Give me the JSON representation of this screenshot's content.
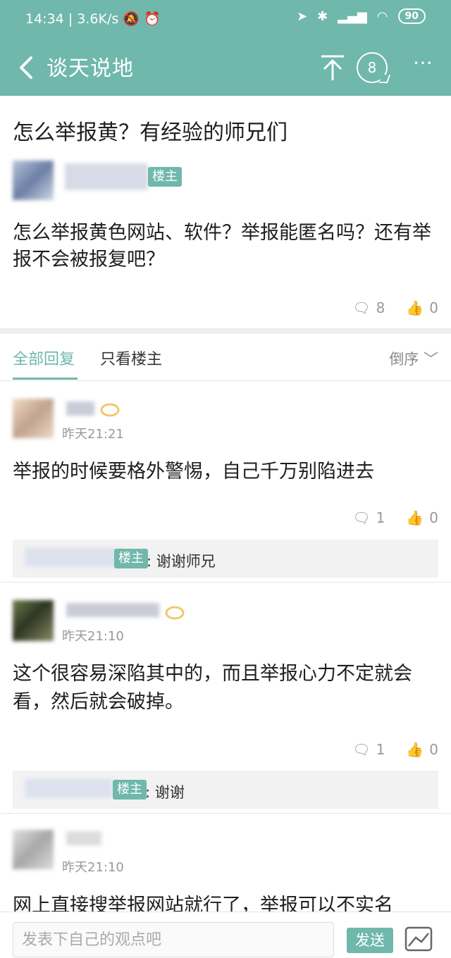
{
  "status": {
    "time": "14:34",
    "speed": "3.6K/s",
    "battery": "90"
  },
  "header": {
    "title": "谈天说地",
    "comment_count": "8"
  },
  "post": {
    "title": "怎么举报黄？有经验的师兄们",
    "author_tag": "楼主",
    "body": "怎么举报黄色网站、软件？举报能匿名吗？还有举报不会被报复吧？",
    "comments": "8",
    "likes": "0"
  },
  "tabs": {
    "all": "全部回复",
    "owner": "只看楼主",
    "sort": "倒序"
  },
  "replies": [
    {
      "time": "昨天21:21",
      "text": "举报的时候要格外警惕，自己千万别陷进去",
      "comments": "1",
      "likes": "0",
      "sub_tag": "楼主",
      "sub_text": "谢谢师兄"
    },
    {
      "time": "昨天21:10",
      "text": "这个很容易深陷其中的，而且举报心力不定就会看，然后就会破掉。",
      "comments": "1",
      "likes": "0",
      "sub_tag": "楼主",
      "sub_text": "谢谢"
    },
    {
      "time": "昨天21:10",
      "text": "网上直接搜举报网站就行了，举报可以不实名"
    }
  ],
  "compose": {
    "placeholder": "发表下自己的观点吧",
    "send": "发送"
  },
  "colors": {
    "accent": "#6fb8ab"
  }
}
